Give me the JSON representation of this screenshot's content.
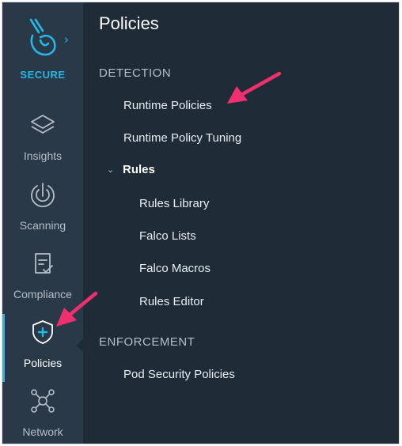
{
  "brand": {
    "label": "SECURE",
    "chevron": "›",
    "logo_icon": "shovel-hand-icon",
    "accent_color": "#27b7e6"
  },
  "sidebar": {
    "items": [
      {
        "label": "Insights",
        "icon": "layers-icon",
        "active": false
      },
      {
        "label": "Scanning",
        "icon": "scan-power-icon",
        "active": false
      },
      {
        "label": "Compliance",
        "icon": "clipboard-check-icon",
        "active": false
      },
      {
        "label": "Policies",
        "icon": "shield-plus-icon",
        "active": true
      },
      {
        "label": "Network",
        "icon": "network-nodes-icon",
        "active": false
      }
    ]
  },
  "main": {
    "title": "Policies",
    "detection": {
      "header": "DETECTION",
      "items": [
        "Runtime Policies",
        "Runtime Policy Tuning"
      ],
      "rules": {
        "label": "Rules",
        "chevron": "⌄",
        "items": [
          "Rules Library",
          "Falco Lists",
          "Falco Macros",
          "Rules Editor"
        ]
      }
    },
    "enforcement": {
      "header": "ENFORCEMENT",
      "items": [
        "Pod Security Policies"
      ]
    }
  },
  "annotation": {
    "arrow_color": "#f0306e"
  }
}
